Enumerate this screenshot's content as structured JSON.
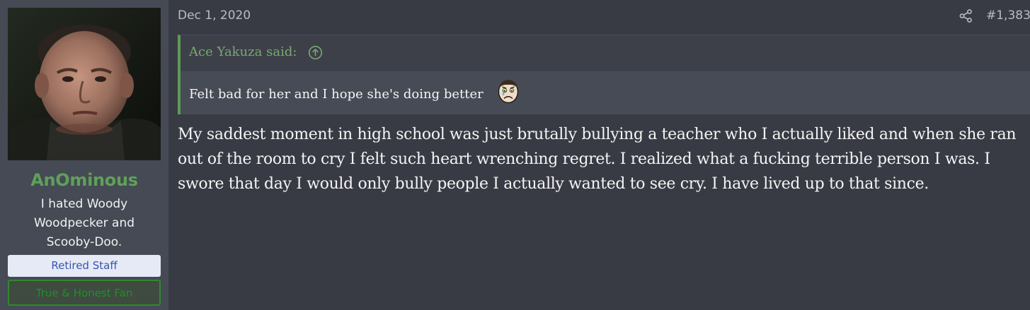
{
  "user": {
    "username": "AnOminous",
    "title_lines": [
      "I hated Woody",
      "Woodpecker and",
      "Scooby-Doo."
    ],
    "banners": [
      {
        "label": "Retired Staff",
        "color": "#3654b4",
        "background": "#e6eaf6"
      },
      {
        "label": "True & Honest Fan",
        "color": "#1f8f2a",
        "border": "#2e8a2e"
      }
    ]
  },
  "post": {
    "date": "Dec 1, 2020",
    "share_icon": "share-icon",
    "number": "#1,383",
    "quote": {
      "author": "Ace Yakuza said:",
      "jump_icon": "arrow-up-circle-icon",
      "text": "Felt bad for her and I hope she's doing better",
      "emoji": "sad-face-emoji"
    },
    "message_lines": [
      "My saddest moment in high school was just brutally bullying a teacher who I actually liked and when she ran",
      "out of the room to cry I felt such heart wrenching regret. I realized what a fucking terrible person I was. I",
      "swore that day I would only bully people I actually wanted to see cry. I have lived up to that since."
    ]
  },
  "colors": {
    "background": "#383b44",
    "sidebar": "#454a54",
    "username": "#5fa05a",
    "quote_accent": "#5e9b54",
    "text": "#f4f4f4",
    "muted": "#b9bcc2"
  }
}
